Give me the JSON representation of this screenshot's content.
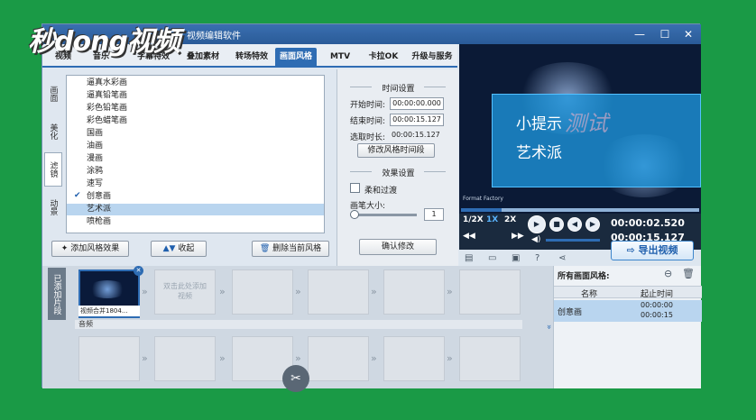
{
  "window": {
    "title": "视频编辑软件",
    "minimize": "—",
    "maximize": "☐",
    "close": "✕"
  },
  "watermark": "秒dong视频",
  "tabs": [
    "视频",
    "音乐",
    "字幕特效",
    "叠加素材",
    "转场特效",
    "画面风格",
    "MTV",
    "卡拉OK",
    "升级与服务"
  ],
  "active_tab": "画面风格",
  "side_tabs": [
    "画面",
    "美化",
    "滤镜",
    "动景"
  ],
  "style_list": [
    "逼真水彩画",
    "逼真铅笔画",
    "彩色铅笔画",
    "彩色蜡笔画",
    "国画",
    "油画",
    "漫画",
    "涂鸦",
    "速写",
    "创意画",
    "艺术派",
    "喷枪画"
  ],
  "selected_style": "艺术派",
  "checked_style": "创意画",
  "list_buttons": {
    "add": "添加风格效果",
    "collapse": "收起",
    "delete": "删除当前风格"
  },
  "time_settings": {
    "title": "时间设置",
    "start_label": "开始时间:",
    "start_value": "00:00:00.000",
    "end_label": "结束时间:",
    "end_value": "00:00:15.127",
    "duration_label": "选取时长:",
    "duration_value": "00:00:15.127",
    "modify_button": "修改风格时间段"
  },
  "effect_settings": {
    "title": "效果设置",
    "smooth_label": "柔和过渡",
    "brush_label": "画笔大小:",
    "brush_value": "1",
    "confirm_button": "确认修改"
  },
  "preview": {
    "overlay_line1": "小提示",
    "overlay_line2": "艺术派",
    "overlay_bg_text": "测试",
    "brand": "Format Factory",
    "current_time": "00:00:02.520",
    "total_time": "00:00:15.127",
    "speeds": [
      "1/2X",
      "1X",
      "2X"
    ],
    "active_speed": "1X",
    "progress_fraction": 0.17,
    "volume_fraction": 0.85
  },
  "export_button": "导出视频",
  "timeline": {
    "side_label": "已添加片段",
    "clip_label": "视频合并1804...",
    "empty_hint": "双击此处添加视频",
    "audio_label": "音频"
  },
  "right_panel": {
    "title": "所有画面风格:",
    "col_name": "名称",
    "col_time": "起止时间",
    "row_name": "创意画",
    "row_start": "00:00:00",
    "row_end": "00:00:15"
  }
}
